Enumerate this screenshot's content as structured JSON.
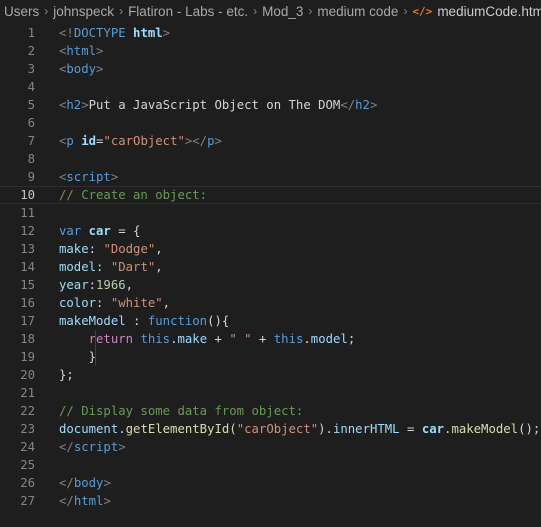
{
  "breadcrumb": {
    "items": [
      "Users",
      "johnspeck",
      "Flatiron - Labs - etc.",
      "Mod_3",
      "medium code"
    ],
    "file_icon": "</>",
    "file_name": "mediumCode.html",
    "separator": "›"
  },
  "editor": {
    "current_line": 10,
    "lines": [
      {
        "num": "1",
        "tokens": [
          {
            "t": "<!",
            "c": "t-punct"
          },
          {
            "t": "DOCTYPE",
            "c": "t-tag"
          },
          {
            "t": " html",
            "c": "t-attr"
          },
          {
            "t": ">",
            "c": "t-punct"
          }
        ]
      },
      {
        "num": "2",
        "tokens": [
          {
            "t": "<",
            "c": "t-punct"
          },
          {
            "t": "html",
            "c": "t-tag"
          },
          {
            "t": ">",
            "c": "t-punct"
          }
        ]
      },
      {
        "num": "3",
        "tokens": [
          {
            "t": "<",
            "c": "t-punct"
          },
          {
            "t": "body",
            "c": "t-tag"
          },
          {
            "t": ">",
            "c": "t-punct"
          }
        ]
      },
      {
        "num": "4",
        "tokens": []
      },
      {
        "num": "5",
        "tokens": [
          {
            "t": "<",
            "c": "t-punct"
          },
          {
            "t": "h2",
            "c": "t-tag"
          },
          {
            "t": ">",
            "c": "t-punct"
          },
          {
            "t": "Put a JavaScript Object on The DOM",
            "c": "t-text"
          },
          {
            "t": "</",
            "c": "t-punct"
          },
          {
            "t": "h2",
            "c": "t-tag"
          },
          {
            "t": ">",
            "c": "t-punct"
          }
        ]
      },
      {
        "num": "6",
        "tokens": []
      },
      {
        "num": "7",
        "tokens": [
          {
            "t": "<",
            "c": "t-punct"
          },
          {
            "t": "p",
            "c": "t-tag"
          },
          {
            "t": " id",
            "c": "t-attr"
          },
          {
            "t": "=",
            "c": "t-text"
          },
          {
            "t": "\"carObject\"",
            "c": "t-str"
          },
          {
            "t": "></",
            "c": "t-punct"
          },
          {
            "t": "p",
            "c": "t-tag"
          },
          {
            "t": ">",
            "c": "t-punct"
          }
        ]
      },
      {
        "num": "8",
        "tokens": []
      },
      {
        "num": "9",
        "tokens": [
          {
            "t": "<",
            "c": "t-punct"
          },
          {
            "t": "script",
            "c": "t-tag"
          },
          {
            "t": ">",
            "c": "t-punct"
          }
        ]
      },
      {
        "num": "10",
        "tokens": [
          {
            "t": "// Create an object:",
            "c": "t-comment"
          }
        ]
      },
      {
        "num": "11",
        "tokens": []
      },
      {
        "num": "12",
        "tokens": [
          {
            "t": "var",
            "c": "t-kw"
          },
          {
            "t": " car",
            "c": "t-var"
          },
          {
            "t": " = {",
            "c": "t-text"
          }
        ]
      },
      {
        "num": "13",
        "tokens": [
          {
            "t": "make",
            "c": "t-var"
          },
          {
            "t": ": ",
            "c": "t-text"
          },
          {
            "t": "\"Dodge\"",
            "c": "t-str"
          },
          {
            "t": ",",
            "c": "t-text"
          }
        ]
      },
      {
        "num": "14",
        "tokens": [
          {
            "t": "model",
            "c": "t-var"
          },
          {
            "t": ": ",
            "c": "t-text"
          },
          {
            "t": "\"Dart\"",
            "c": "t-str"
          },
          {
            "t": ",",
            "c": "t-text"
          }
        ]
      },
      {
        "num": "15",
        "tokens": [
          {
            "t": "year",
            "c": "t-var"
          },
          {
            "t": ":",
            "c": "t-text"
          },
          {
            "t": "1966",
            "c": "t-num"
          },
          {
            "t": ",",
            "c": "t-text"
          }
        ]
      },
      {
        "num": "16",
        "tokens": [
          {
            "t": "color",
            "c": "t-var"
          },
          {
            "t": ": ",
            "c": "t-text"
          },
          {
            "t": "\"white\"",
            "c": "t-str"
          },
          {
            "t": ",",
            "c": "t-text"
          }
        ]
      },
      {
        "num": "17",
        "tokens": [
          {
            "t": "makeModel",
            "c": "t-var"
          },
          {
            "t": " : ",
            "c": "t-text"
          },
          {
            "t": "function",
            "c": "t-kw"
          },
          {
            "t": "(){",
            "c": "t-text"
          }
        ]
      },
      {
        "num": "18",
        "guide": true,
        "tokens": [
          {
            "t": "    ",
            "c": "t-text"
          },
          {
            "t": "return",
            "c": "t-ctl"
          },
          {
            "t": " this",
            "c": "t-kw"
          },
          {
            "t": ".",
            "c": "t-text"
          },
          {
            "t": "make",
            "c": "t-var"
          },
          {
            "t": " + ",
            "c": "t-text"
          },
          {
            "t": "\" \"",
            "c": "t-str"
          },
          {
            "t": " + ",
            "c": "t-text"
          },
          {
            "t": "this",
            "c": "t-kw"
          },
          {
            "t": ".",
            "c": "t-text"
          },
          {
            "t": "model",
            "c": "t-var"
          },
          {
            "t": ";",
            "c": "t-text"
          }
        ]
      },
      {
        "num": "19",
        "guide": true,
        "tokens": [
          {
            "t": "    }",
            "c": "t-text"
          }
        ]
      },
      {
        "num": "20",
        "tokens": [
          {
            "t": "};",
            "c": "t-text"
          }
        ]
      },
      {
        "num": "21",
        "tokens": []
      },
      {
        "num": "22",
        "tokens": [
          {
            "t": "// Display some data from object:",
            "c": "t-comment"
          }
        ]
      },
      {
        "num": "23",
        "tokens": [
          {
            "t": "document",
            "c": "t-var"
          },
          {
            "t": ".",
            "c": "t-text"
          },
          {
            "t": "getElementById",
            "c": "t-fn"
          },
          {
            "t": "(",
            "c": "t-text"
          },
          {
            "t": "\"carObject\"",
            "c": "t-str"
          },
          {
            "t": ").",
            "c": "t-text"
          },
          {
            "t": "innerHTML",
            "c": "t-var"
          },
          {
            "t": " = ",
            "c": "t-text"
          },
          {
            "t": "car",
            "c": "t-var"
          },
          {
            "t": ".",
            "c": "t-text"
          },
          {
            "t": "makeModel",
            "c": "t-fn"
          },
          {
            "t": "();",
            "c": "t-text"
          }
        ]
      },
      {
        "num": "24",
        "tokens": [
          {
            "t": "</",
            "c": "t-punct"
          },
          {
            "t": "script",
            "c": "t-tag"
          },
          {
            "t": ">",
            "c": "t-punct"
          }
        ]
      },
      {
        "num": "25",
        "tokens": []
      },
      {
        "num": "26",
        "tokens": [
          {
            "t": "</",
            "c": "t-punct"
          },
          {
            "t": "body",
            "c": "t-tag"
          },
          {
            "t": ">",
            "c": "t-punct"
          }
        ]
      },
      {
        "num": "27",
        "tokens": [
          {
            "t": "</",
            "c": "t-punct"
          },
          {
            "t": "html",
            "c": "t-tag"
          },
          {
            "t": ">",
            "c": "t-punct"
          }
        ]
      }
    ]
  },
  "colors": {
    "background": "#1e1e1e",
    "tag": "#569cd6",
    "string": "#ce9178",
    "comment": "#6a9955",
    "variable": "#9cdcfe",
    "function": "#dcdcaa",
    "number": "#b5cea8",
    "control": "#c586c0",
    "file_icon": "#e37933"
  }
}
